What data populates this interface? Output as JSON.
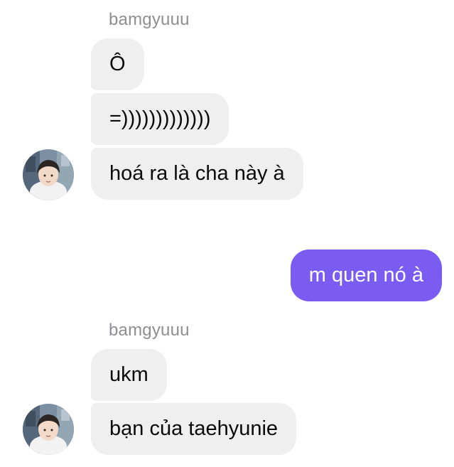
{
  "chat": {
    "groups": [
      {
        "sender": "bamgyuuu",
        "messages": [
          "Ô",
          "=)))))))))))))",
          "hoá ra là cha này à"
        ]
      },
      {
        "outgoing": [
          "m quen nó à"
        ]
      },
      {
        "sender": "bamgyuuu",
        "messages": [
          "ukm",
          "bạn của taehyunie"
        ]
      }
    ]
  },
  "colors": {
    "incoming_bubble": "#efefef",
    "outgoing_bubble": "#7b5cf2",
    "sender_name": "#8e8e93"
  },
  "icons": {
    "avatar": "user-avatar-photo"
  }
}
